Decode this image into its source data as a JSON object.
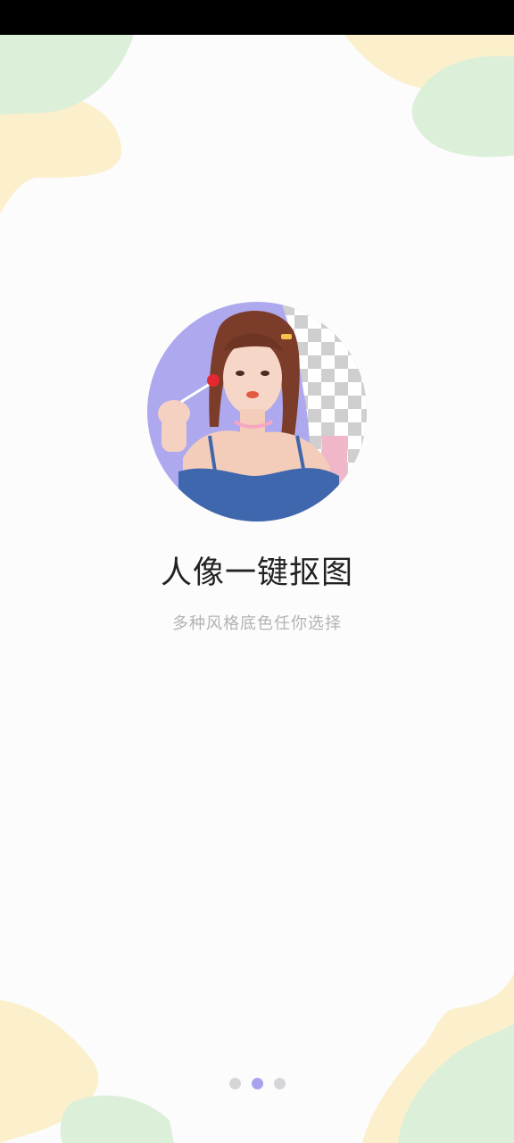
{
  "onboarding": {
    "title": "人像一键抠图",
    "subtitle": "多种风格底色任你选择",
    "hero_image": "portrait cutout illustration with transparent checkerboard background",
    "pager": {
      "current": 2,
      "total": 3
    }
  },
  "colors": {
    "accent_dot": "#a8a3ee",
    "inactive_dot": "#d6d6d9",
    "title": "#222222",
    "subtitle": "#b3b3b3",
    "decor_green": "#dcefd6",
    "decor_yellow": "#fbf0c9"
  }
}
